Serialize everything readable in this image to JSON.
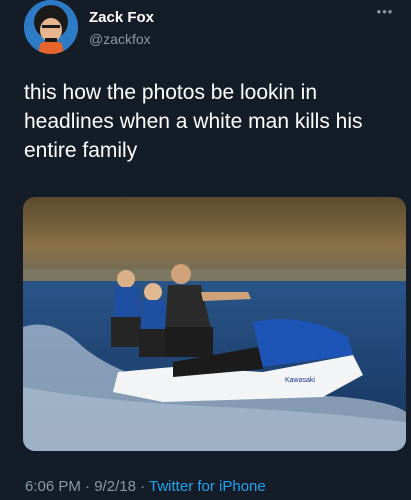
{
  "user": {
    "display_name": "Zack Fox",
    "handle": "@zackfox",
    "avatar_icon": "avatar-image"
  },
  "menu": {
    "more_label": "•••"
  },
  "tweet": {
    "text": "this how the photos be lookin in\nheadlines when a white man kills his\nentire family",
    "media": {
      "description_icon": "photo-jetski",
      "brand_text": "Kawasaki"
    }
  },
  "meta": {
    "time": "6:06 PM",
    "separator": "·",
    "date": "9/2/18",
    "source": "Twitter for iPhone"
  },
  "colors": {
    "background": "#141d27",
    "text_primary": "#ffffff",
    "text_secondary": "#8899a6",
    "link": "#1da1f2"
  }
}
